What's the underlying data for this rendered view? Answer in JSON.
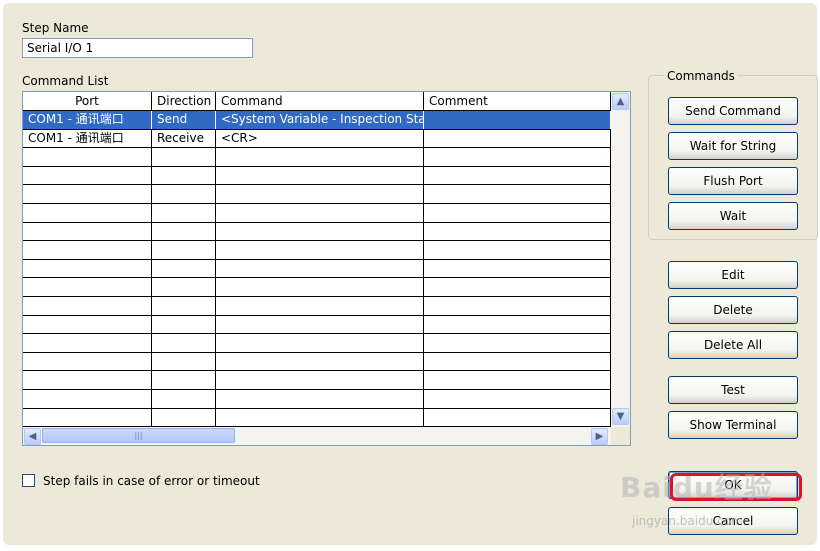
{
  "step_name": {
    "label": "Step Name",
    "value": "Serial I/O 1"
  },
  "command_list": {
    "label": "Command List",
    "columns": [
      "Port",
      "Direction",
      "Command",
      "Comment"
    ],
    "rows": [
      {
        "port": "COM1 - 通讯端口",
        "direction": "Send",
        "command": "<System Variable - Inspection Status",
        "comment": "",
        "selected": true
      },
      {
        "port": "COM1 - 通讯端口",
        "direction": "Receive",
        "command": "<CR>",
        "comment": "",
        "selected": false
      }
    ],
    "empty_rows": 15,
    "scroll": {
      "up": "▲",
      "down": "▼",
      "left": "◀",
      "right": "▶",
      "grip": "|||"
    }
  },
  "commands_group": {
    "title": "Commands",
    "buttons": [
      "Send Command",
      "Wait for String",
      "Flush Port",
      "Wait"
    ]
  },
  "side_buttons": [
    "Edit",
    "Delete",
    "Delete All",
    "Test",
    "Show Terminal"
  ],
  "checkbox": {
    "label": "Step fails in case of error or timeout",
    "checked": false
  },
  "dialog_buttons": {
    "ok": "OK",
    "cancel": "Cancel"
  },
  "watermark": {
    "main": "Baidu经验",
    "sub": "jingyan.baidu.com"
  },
  "colors": {
    "dialog_bg": "#ECE9D8",
    "selection": "#316AC5",
    "highlight": "#E0102C"
  }
}
